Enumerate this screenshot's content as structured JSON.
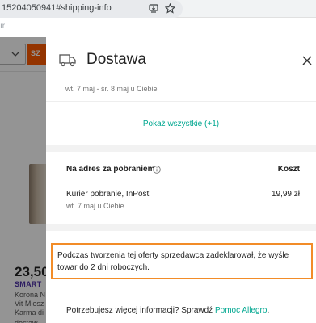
{
  "browser": {
    "url": "15204050941#shipping-info",
    "back_hint": "ır"
  },
  "background": {
    "search_button_label": "SZ",
    "price": "23,50",
    "smart_label": "SMART",
    "product_lines": [
      "Korona N",
      "Vit Miesz",
      "Karma di",
      "dostaw"
    ]
  },
  "drawer": {
    "icon": "truck-icon",
    "title": "Dostawa",
    "close_icon": "close-icon",
    "previous_option_date": "wt. 7 maj - śr. 8 maj u Ciebie",
    "show_all_label": "Pokaż wszystkie (+1)",
    "table": {
      "header_label": "Na adres za pobraniem",
      "header_cost": "Koszt",
      "rows": [
        {
          "name": "Kurier pobranie, InPost",
          "price": "19,99 zł",
          "date": "wt. 7 maj u Ciebie"
        }
      ]
    },
    "notice": "Podczas tworzenia tej oferty sprzedawca zadeklarował, że wyśle towar do 2 dni roboczych.",
    "help": {
      "question": "Potrzebujesz więcej informacji? Sprawdź ",
      "link": "Pomoc Allegro",
      "suffix": "."
    }
  },
  "colors": {
    "accent_teal": "#00a790",
    "brand_orange": "#ff5a00",
    "highlight_border": "#f28c28"
  }
}
